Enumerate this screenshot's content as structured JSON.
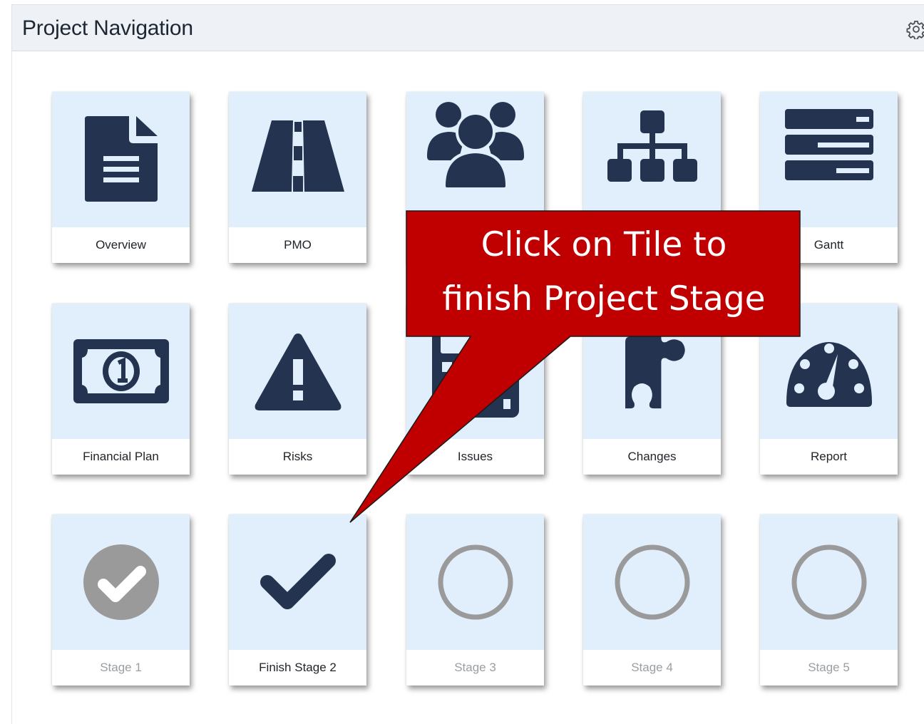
{
  "panel": {
    "title": "Project Navigation",
    "settings_icon": "gear-icon"
  },
  "tiles": [
    {
      "label": "Overview",
      "icon": "document-icon",
      "state": "active"
    },
    {
      "label": "PMO",
      "icon": "road-icon",
      "state": "active"
    },
    {
      "label": "",
      "icon": "team-icon",
      "state": "active"
    },
    {
      "label": "",
      "icon": "org-chart-icon",
      "state": "active"
    },
    {
      "label": "Gantt",
      "icon": "gantt-icon",
      "state": "active"
    },
    {
      "label": "Financial Plan",
      "icon": "banknote-icon",
      "state": "active"
    },
    {
      "label": "Risks",
      "icon": "warning-icon",
      "state": "active"
    },
    {
      "label": "Issues",
      "icon": "calculator-icon",
      "state": "active"
    },
    {
      "label": "Changes",
      "icon": "puzzle-icon",
      "state": "active"
    },
    {
      "label": "Report",
      "icon": "dashboard-gauge-icon",
      "state": "active"
    },
    {
      "label": "Stage 1",
      "icon": "check-circle-icon",
      "state": "completed"
    },
    {
      "label": "Finish Stage 2",
      "icon": "checkmark-icon",
      "state": "current"
    },
    {
      "label": "Stage 3",
      "icon": "empty-circle-icon",
      "state": "pending"
    },
    {
      "label": "Stage 4",
      "icon": "empty-circle-icon",
      "state": "pending"
    },
    {
      "label": "Stage 5",
      "icon": "empty-circle-icon",
      "state": "pending"
    }
  ],
  "callout": {
    "line1": "Click on Tile to",
    "line2": "finish Project Stage"
  },
  "colors": {
    "icon_dark": "#233350",
    "icon_disabled": "#9a9a9a",
    "tile_bg": "#e1eefb",
    "callout_fill": "#c00000",
    "header_bg": "#eef1f5"
  }
}
